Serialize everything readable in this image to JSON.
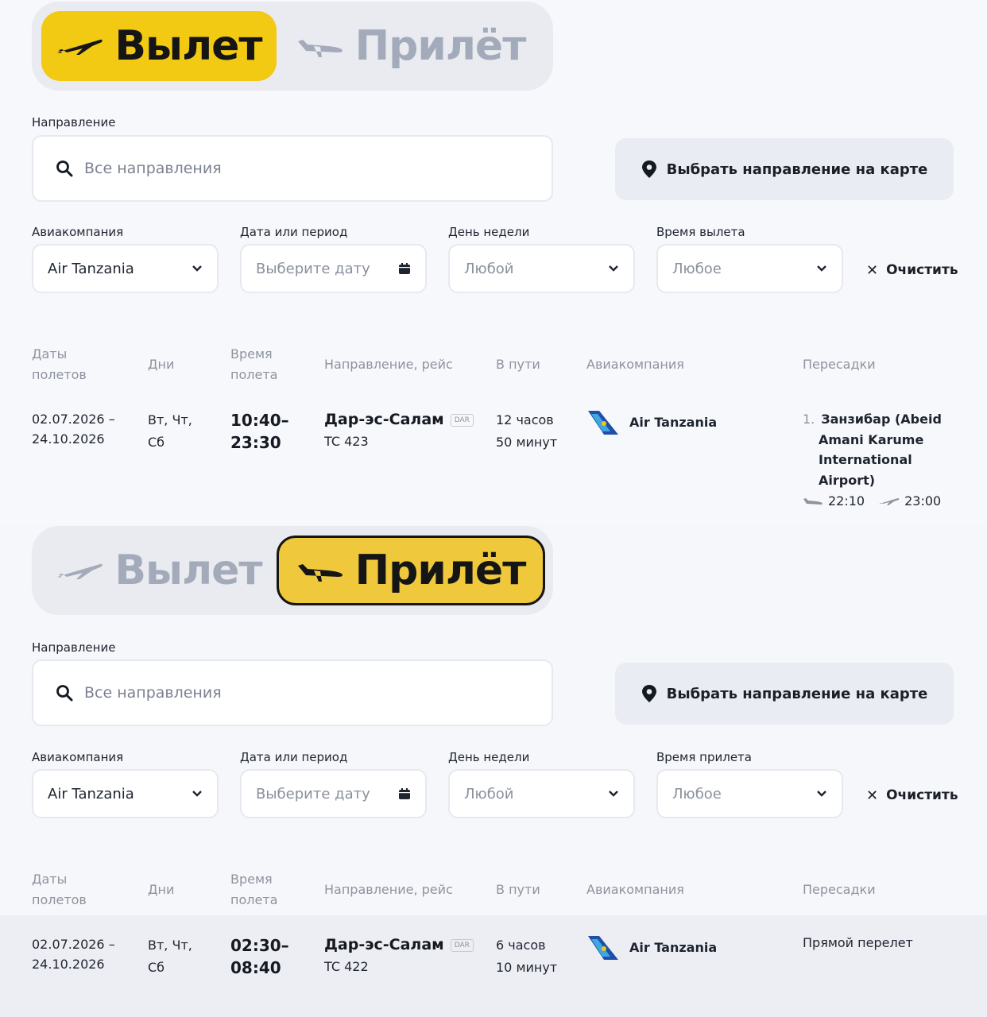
{
  "departures": {
    "toggle": {
      "departure": "Вылет",
      "arrival": "Прилёт",
      "active": "departure"
    },
    "direction_label": "Направление",
    "search_placeholder": "Все направления",
    "map_button": "Выбрать направление на карте",
    "filters": {
      "airline_label": "Авиакомпания",
      "airline_value": "Air Tanzania",
      "date_label": "Дата или период",
      "date_placeholder": "Выберите дату",
      "weekday_label": "День недели",
      "weekday_value": "Любой",
      "time_label": "Время вылета",
      "time_value": "Любое",
      "clear": "Очистить"
    },
    "table": {
      "headers": {
        "dates_1": "Даты",
        "dates_2": "полетов",
        "days": "Дни",
        "time_1": "Время",
        "time_2": "полета",
        "direction": "Направление, рейс",
        "duration": "В пути",
        "airline": "Авиакомпания",
        "transfers": "Пересадки"
      },
      "row": {
        "date_from": "02.07.2026 –",
        "date_to": "24.10.2026",
        "days_1": "Вт, Чт,",
        "days_2": "Сб",
        "time_start": "10:40–",
        "time_end": "23:30",
        "destination": "Дар-эс-Салам",
        "iata": "DAR",
        "flight": "TC 423",
        "duration_1": "12 часов",
        "duration_2": "50 минут",
        "airline": "Air Tanzania",
        "transfer_num": "1.",
        "transfer_1": "Занзибар (Abeid",
        "transfer_2": "Amani Karume",
        "transfer_3": "International",
        "transfer_4": "Airport)",
        "transfer_arr": "22:10",
        "transfer_dep": "23:00"
      }
    }
  },
  "arrivals": {
    "toggle": {
      "departure": "Вылет",
      "arrival": "Прилёт",
      "active": "arrival"
    },
    "direction_label": "Направление",
    "search_placeholder": "Все направления",
    "map_button": "Выбрать направление на карте",
    "filters": {
      "airline_label": "Авиакомпания",
      "airline_value": "Air Tanzania",
      "date_label": "Дата или период",
      "date_placeholder": "Выберите дату",
      "weekday_label": "День недели",
      "weekday_value": "Любой",
      "time_label": "Время прилета",
      "time_value": "Любое",
      "clear": "Очистить"
    },
    "table": {
      "headers": {
        "dates_1": "Даты",
        "dates_2": "полетов",
        "days": "Дни",
        "time_1": "Время",
        "time_2": "полета",
        "direction": "Направление, рейс",
        "duration": "В пути",
        "airline": "Авиакомпания",
        "transfers": "Пересадки"
      },
      "row": {
        "date_from": "02.07.2026 –",
        "date_to": "24.10.2026",
        "days_1": "Вт, Чт,",
        "days_2": "Сб",
        "time_start": "02:30–",
        "time_end": "08:40",
        "destination": "Дар-эс-Салам",
        "iata": "DAR",
        "flight": "TC 422",
        "duration_1": "6 часов",
        "duration_2": "10 минут",
        "airline": "Air Tanzania",
        "transfer": "Прямой перелет"
      }
    }
  },
  "colors": {
    "accent_yellow": "#f2c913",
    "toggle_bg": "#e9ebf0",
    "inactive_text": "#a3abbb",
    "row_highlight": "#eceef4"
  }
}
